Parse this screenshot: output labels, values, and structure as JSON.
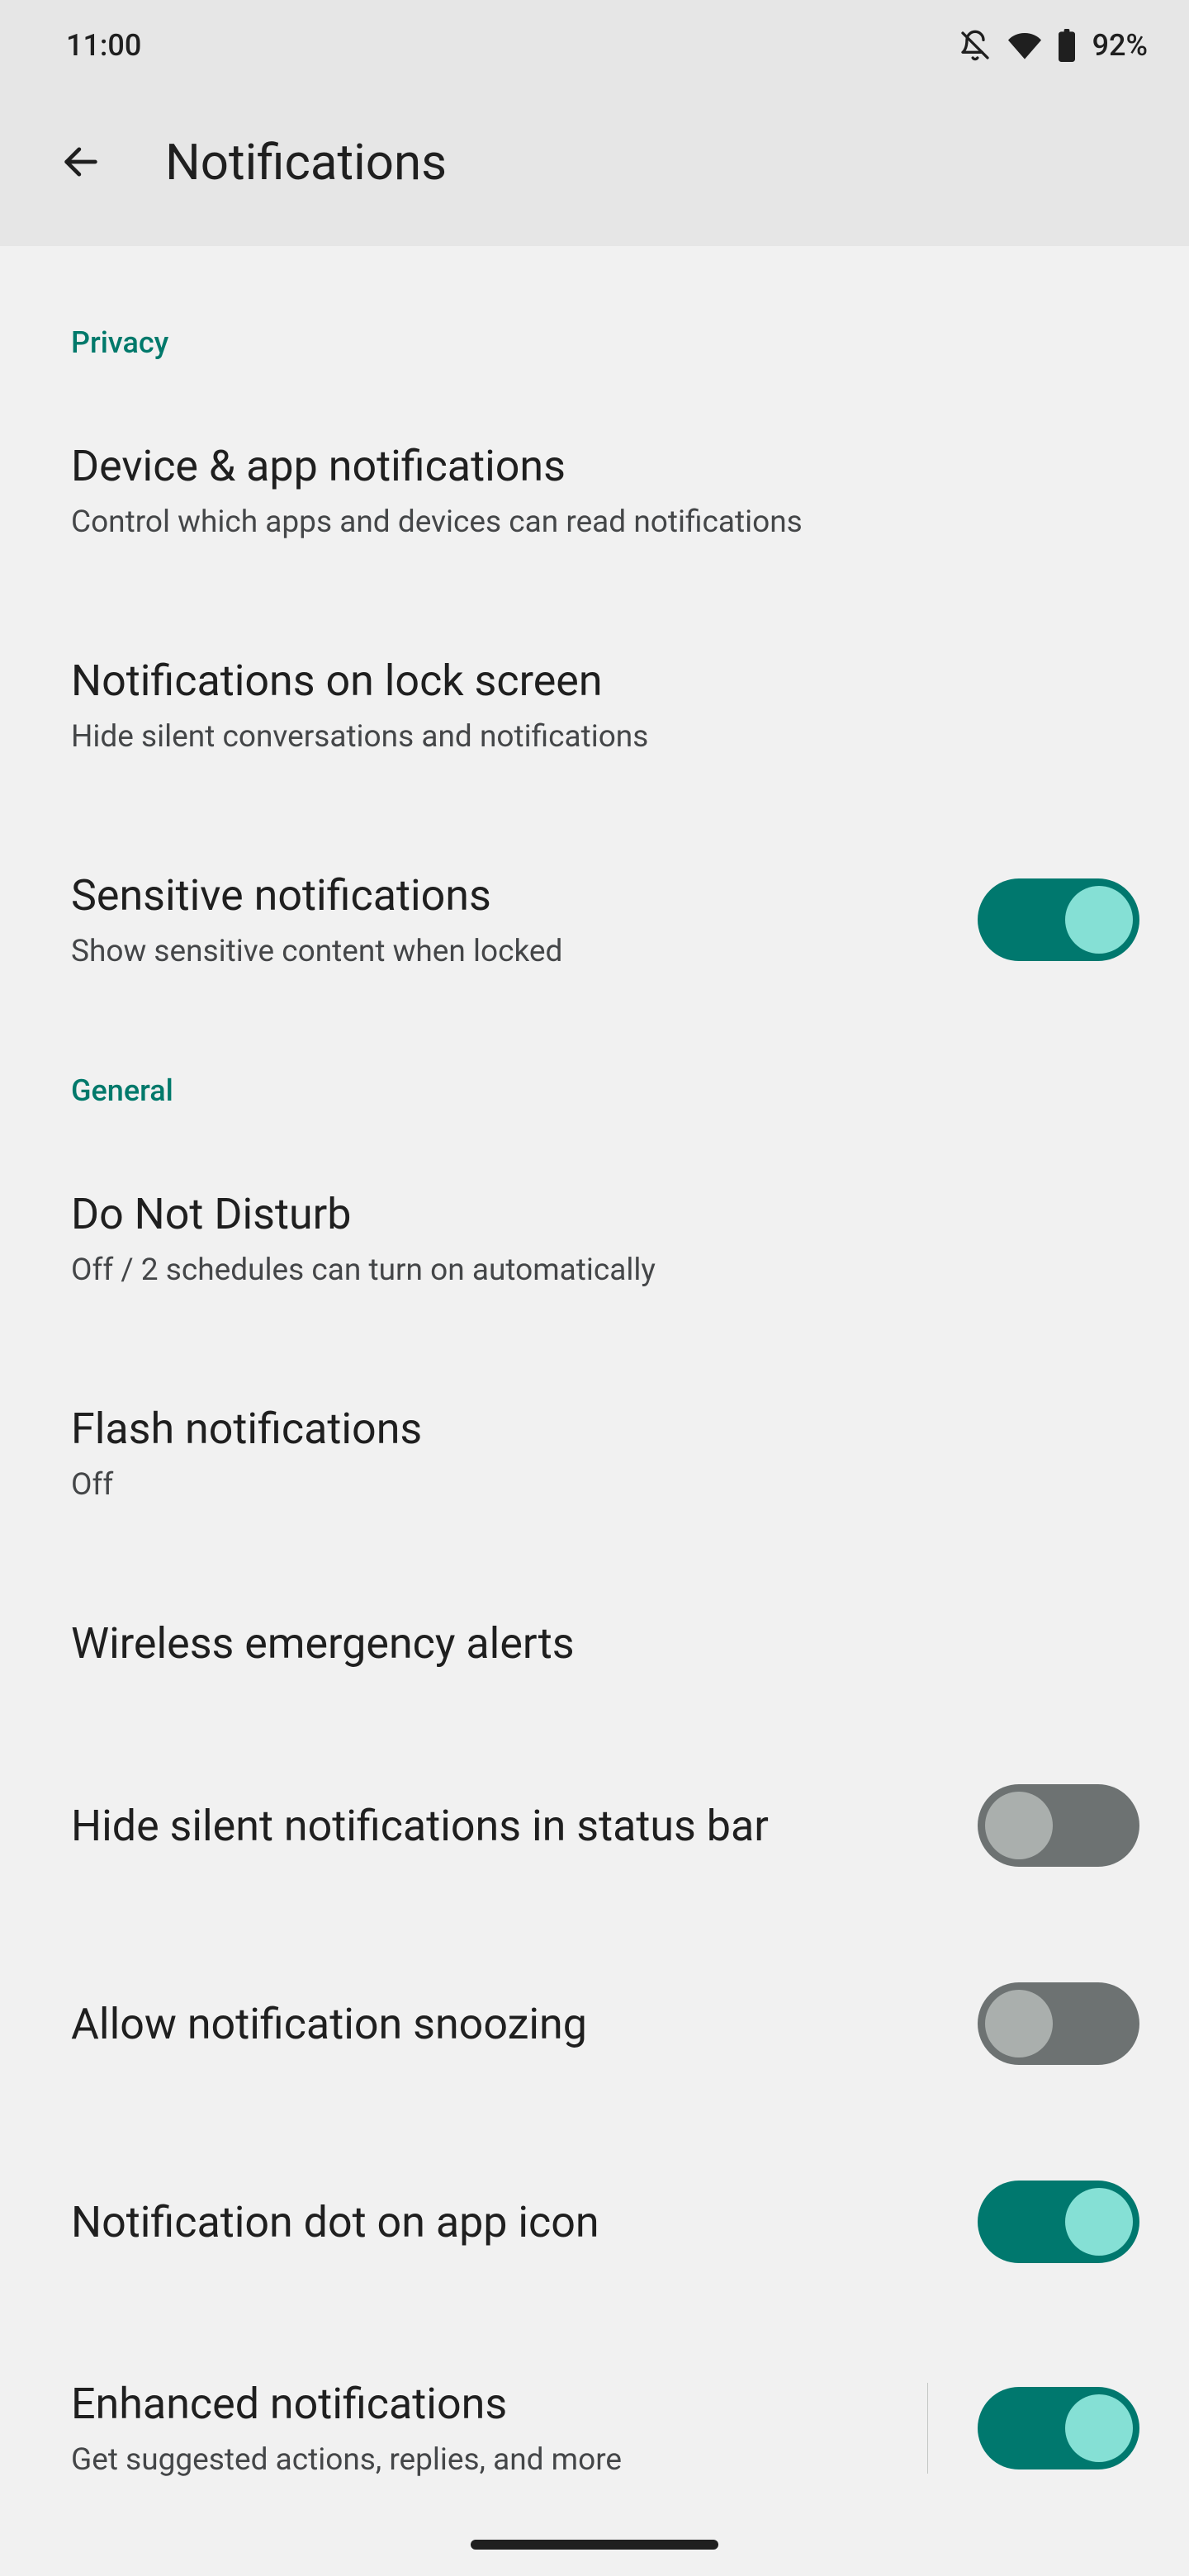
{
  "status": {
    "time": "11:00",
    "battery": "92%"
  },
  "header": {
    "title": "Notifications"
  },
  "sections": [
    {
      "header": "Privacy",
      "items": [
        {
          "title": "Device & app notifications",
          "subtitle": "Control which apps and devices can read notifications"
        },
        {
          "title": "Notifications on lock screen",
          "subtitle": "Hide silent conversations and notifications"
        },
        {
          "title": "Sensitive notifications",
          "subtitle": "Show sensitive content when locked",
          "toggle": true
        }
      ]
    },
    {
      "header": "General",
      "items": [
        {
          "title": "Do Not Disturb",
          "subtitle": "Off / 2 schedules can turn on automatically"
        },
        {
          "title": "Flash notifications",
          "subtitle": "Off"
        },
        {
          "title": "Wireless emergency alerts"
        },
        {
          "title": "Hide silent notifications in status bar",
          "toggle": false
        },
        {
          "title": "Allow notification snoozing",
          "toggle": false
        },
        {
          "title": "Notification dot on app icon",
          "toggle": true
        },
        {
          "title": "Enhanced notifications",
          "subtitle": "Get suggested actions, replies, and more",
          "toggle": true,
          "separator": true
        }
      ]
    }
  ]
}
